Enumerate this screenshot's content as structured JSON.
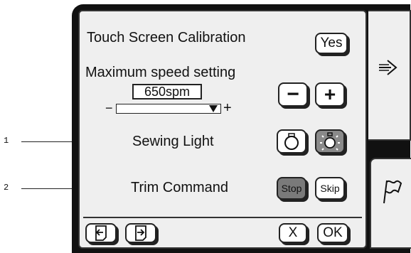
{
  "callouts": [
    "1",
    "2"
  ],
  "settings": {
    "calibration": {
      "label": "Touch Screen Calibration",
      "button": "Yes"
    },
    "max_speed": {
      "label": "Maximum speed setting",
      "value": "650spm",
      "minus_sign": "−",
      "plus_sign": "+",
      "decrease_label": "−",
      "increase_label": "+"
    },
    "sewing_light": {
      "label": "Sewing Light",
      "off_icon": "light-off-icon",
      "on_icon": "light-on-icon"
    },
    "trim_command": {
      "label": "Trim Command",
      "stop": "Stop",
      "skip": "Skip"
    }
  },
  "footer": {
    "cancel": "X",
    "ok": "OK",
    "prev_icon": "page-back-icon",
    "next_icon": "page-forward-icon"
  },
  "side_tabs": {
    "top_icon": "arrow-right-icon",
    "bottom_icon": "flag-icon"
  }
}
